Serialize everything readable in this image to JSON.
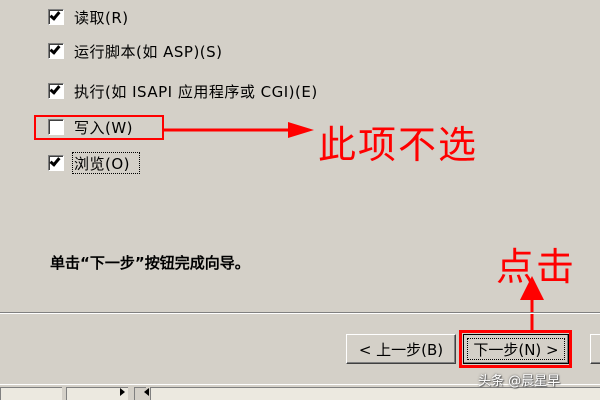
{
  "permissions": [
    {
      "label": "读取(R)",
      "checked": true
    },
    {
      "label": "运行脚本(如 ASP)(S)",
      "checked": true
    },
    {
      "label": "执行(如 ISAPI 应用程序或 CGI)(E)",
      "checked": true
    },
    {
      "label": "写入(W)",
      "checked": false
    },
    {
      "label": "浏览(O)",
      "checked": true
    }
  ],
  "instruction": "单击“下一步”按钮完成向导。",
  "buttons": {
    "back": "< 上一步(B)",
    "next": "下一步(N) >"
  },
  "annotations": {
    "skip_note": "此项不选",
    "click_note": "点击",
    "color": "#ff0000"
  },
  "watermark": "头条 @晨星早"
}
